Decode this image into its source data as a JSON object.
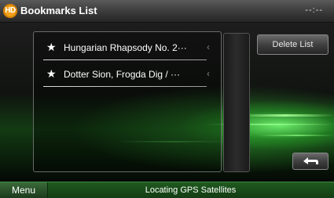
{
  "header": {
    "logo_text": "HD",
    "title": "Bookmarks List",
    "clock": "--:--"
  },
  "bookmarks": [
    {
      "label": "Hungarian Rhapsody No. 2···",
      "icon": "star-icon"
    },
    {
      "label": "Dotter Sion, Frogda Dig / ···",
      "icon": "star-icon"
    }
  ],
  "buttons": {
    "delete_list": "Delete List",
    "back_icon": "return-arrow-icon"
  },
  "footer": {
    "menu": "Menu",
    "status": "Locating GPS Satellites"
  },
  "colors": {
    "logo": "#f3a21a",
    "footer_green": "#1f5a1f"
  }
}
